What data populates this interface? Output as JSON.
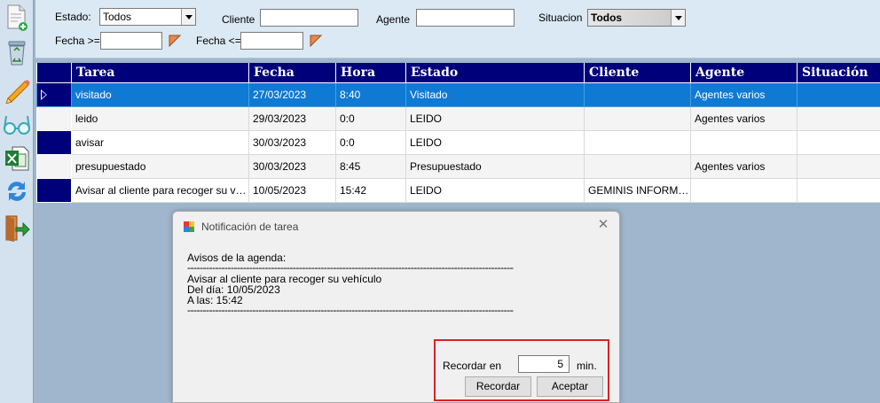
{
  "toolbar": {
    "icons": [
      "new-document-icon",
      "recycle-bin-icon",
      "pencil-icon",
      "glasses-icon",
      "excel-icon",
      "refresh-icon",
      "exit-icon"
    ]
  },
  "filters": {
    "estado_label": "Estado:",
    "estado_value": "Todos",
    "cliente_label": "Cliente",
    "cliente_value": "",
    "agente_label": "Agente",
    "agente_value": "",
    "situacion_label": "Situacion",
    "situacion_value": "Todos",
    "fecha_desde_label": "Fecha >=",
    "fecha_desde_value": "",
    "fecha_hasta_label": "Fecha <=",
    "fecha_hasta_value": ""
  },
  "grid": {
    "columns": [
      "Tarea",
      "Fecha",
      "Hora",
      "Estado",
      "Cliente",
      "Agente",
      "Situación"
    ],
    "rows": [
      [
        "visitado",
        "27/03/2023",
        "8:40",
        "Visitado",
        "",
        "Agentes varios",
        ""
      ],
      [
        "leido",
        "29/03/2023",
        "0:0",
        "LEIDO",
        "",
        "Agentes varios",
        ""
      ],
      [
        "avisar",
        "30/03/2023",
        "0:0",
        "LEIDO",
        "",
        "",
        ""
      ],
      [
        "presupuestado",
        "30/03/2023",
        "8:45",
        "Presupuestado",
        "",
        "Agentes varios",
        ""
      ],
      [
        "Avisar al cliente para recoger su vehículo",
        "10/05/2023",
        "15:42",
        "LEIDO",
        "GEMINIS INFORMÁTICA",
        "",
        ""
      ]
    ],
    "selected_row": 0
  },
  "dialog": {
    "title": "Notificación de tarea",
    "close": "✕",
    "heading": "Avisos de la agenda:",
    "separator": "------------------------------------------------------------------------------------------------------------",
    "task": "Avisar al cliente para recoger su vehículo",
    "day": "Del día: 10/05/2023",
    "time": "A las: 15:42",
    "remind_label": "Recordar en",
    "remind_value": "5",
    "minutes_label": "min.",
    "remind_button": "Recordar",
    "accept_button": "Aceptar"
  },
  "colors": {
    "header_bg": "#00007a",
    "selection_bg": "#0e7ad4",
    "highlight_border": "#e01f26"
  }
}
